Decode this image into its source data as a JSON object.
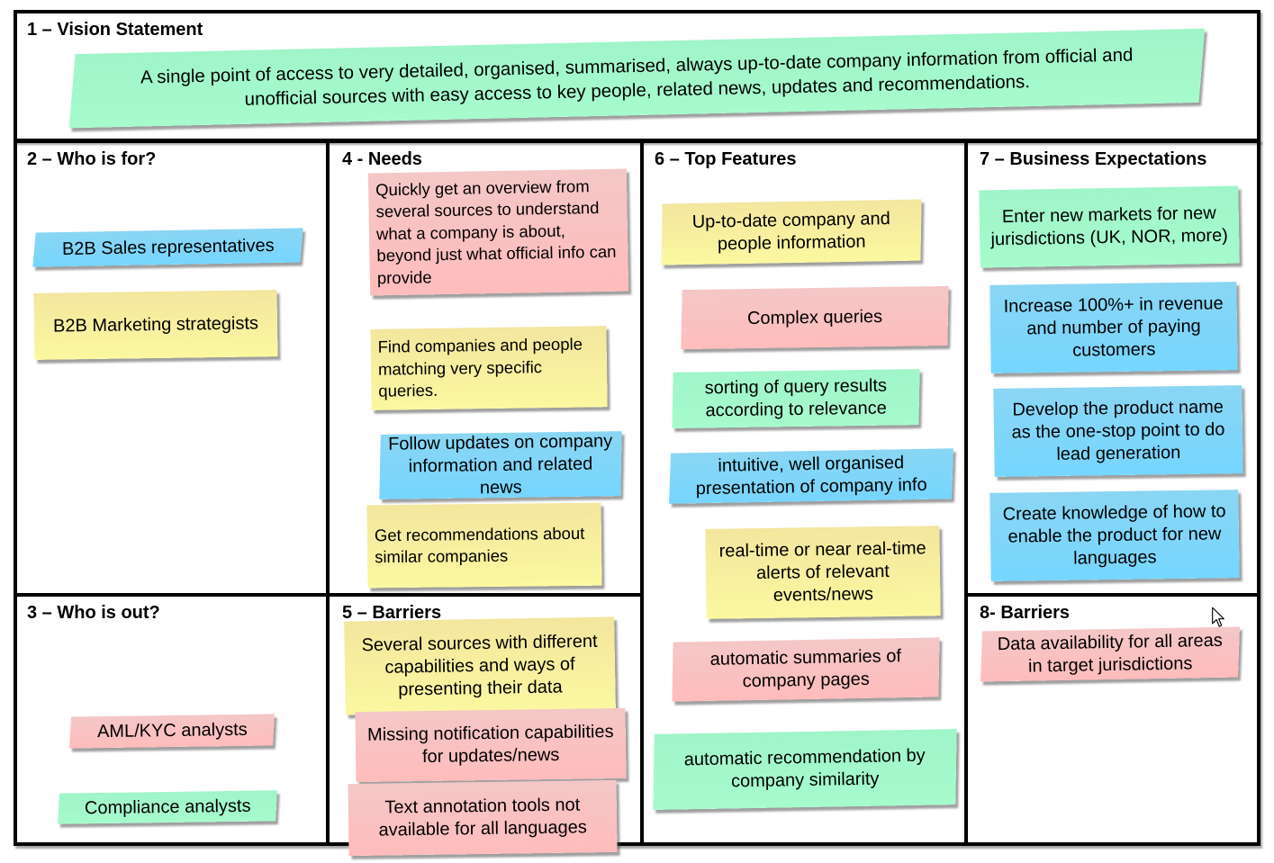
{
  "canvas": {
    "sections": {
      "vision": {
        "title": "1 – Vision Statement"
      },
      "who_for": {
        "title": "2 – Who is for?"
      },
      "who_out": {
        "title": "3 – Who is out?"
      },
      "needs": {
        "title": "4 - Needs"
      },
      "barriers_5": {
        "title": "5 – Barriers"
      },
      "top_features": {
        "title": "6 – Top Features"
      },
      "business_expectations": {
        "title": "7 – Business Expectations"
      },
      "barriers_8": {
        "title": "8- Barriers"
      }
    },
    "notes": {
      "vision": {
        "text": "A single point of access to very detailed, organised, summarised, always up-to-date company information from official and unofficial sources with easy access to key people, related news, updates and recommendations.",
        "color": "green"
      },
      "who_for": [
        {
          "text": "B2B Sales representatives",
          "color": "blue"
        },
        {
          "text": "B2B Marketing strategists",
          "color": "yellow"
        }
      ],
      "who_out": [
        {
          "text": "AML/KYC analysts",
          "color": "pink"
        },
        {
          "text": "Compliance analysts",
          "color": "green"
        }
      ],
      "needs": [
        {
          "text": "Quickly get an overview from several sources to understand what a company is about, beyond just what official info can provide",
          "color": "pink"
        },
        {
          "text": "Find companies and people matching very specific queries.",
          "color": "yellow"
        },
        {
          "text": "Follow updates on company information and related news",
          "color": "blue"
        },
        {
          "text": "Get recommendations about similar companies",
          "color": "yellow"
        }
      ],
      "barriers_5": [
        {
          "text": "Several sources with different capabilities and ways of presenting their data",
          "color": "yellow"
        },
        {
          "text": "Missing notification capabilities for updates/news",
          "color": "pink"
        },
        {
          "text": "Text annotation tools not available for all languages",
          "color": "pink"
        }
      ],
      "top_features": [
        {
          "text": "Up-to-date company and people information",
          "color": "yellow"
        },
        {
          "text": "Complex queries",
          "color": "pink"
        },
        {
          "text": "sorting of query results according to relevance",
          "color": "green"
        },
        {
          "text": "intuitive, well organised presentation of company info",
          "color": "blue"
        },
        {
          "text": "real-time or near real-time alerts of relevant events/news",
          "color": "yellow"
        },
        {
          "text": "automatic summaries of company pages",
          "color": "pink"
        },
        {
          "text": "automatic recommendation by company similarity",
          "color": "green"
        }
      ],
      "business_expectations": [
        {
          "text": "Enter new markets for new jurisdictions (UK, NOR, more)",
          "color": "green"
        },
        {
          "text": "Increase 100%+ in revenue and number of paying customers",
          "color": "blue"
        },
        {
          "text": "Develop the product name as the one-stop point to do lead generation",
          "color": "blue"
        },
        {
          "text": "Create knowledge of how to enable the product for new languages",
          "color": "blue"
        }
      ],
      "barriers_8": [
        {
          "text": "Data availability for all areas in target jurisdictions",
          "color": "pink"
        }
      ]
    },
    "palette": {
      "green": "#a2f8cb",
      "blue": "#7fd6fa",
      "yellow": "#f8efa0",
      "pink": "#fac1c1"
    }
  }
}
